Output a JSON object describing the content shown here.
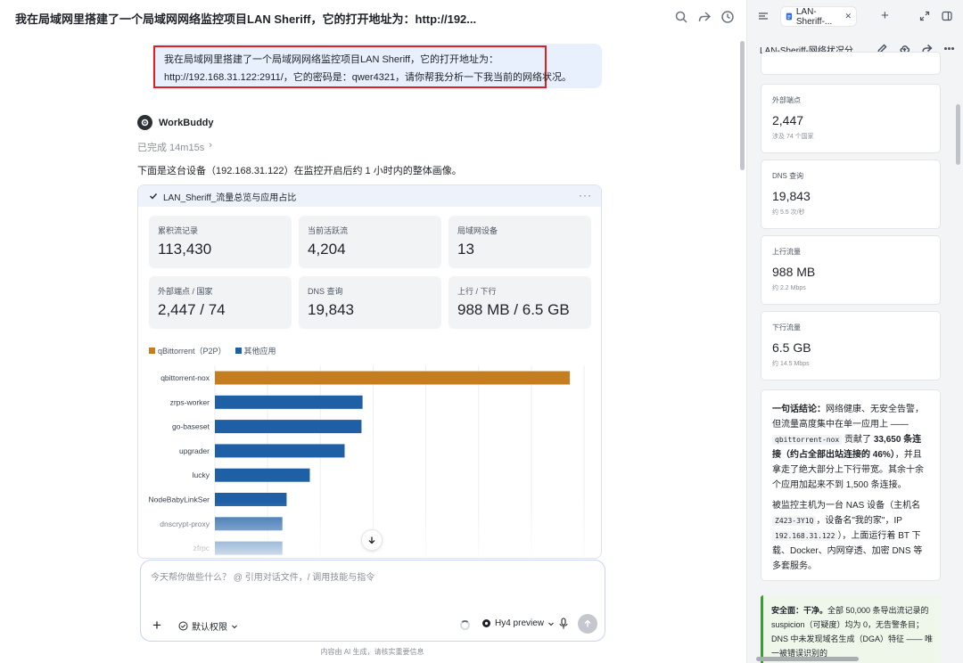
{
  "chat": {
    "title": "我在局域网里搭建了一个局域网网络监控项目LAN Sheriff，它的打开地址为：http://192...",
    "user_message_line1": "我在局域网里搭建了一个局域网网络监控项目LAN Sheriff，它的打开地址为：",
    "user_message_line2": "http://192.168.31.122:2911/，它的密码是：qwer4321，请你帮我分析一下我当前的网络状况。",
    "bot_name": "WorkBuddy",
    "done_label": "已完成 14m15s",
    "done_chevron": "›",
    "intro": "下面是这台设备（192.168.31.122）在监控开启后约 1 小时内的整体画像。"
  },
  "card": {
    "title": "LAN_Sheriff_流量总览与应用占比",
    "more": "···",
    "stats": [
      {
        "label": "累积流记录",
        "value": "113,430"
      },
      {
        "label": "当前活跃流",
        "value": "4,204"
      },
      {
        "label": "局域网设备",
        "value": "13"
      },
      {
        "label": "外部端点 / 国家",
        "value": "2,447 / 74"
      },
      {
        "label": "DNS 查询",
        "value": "19,843"
      },
      {
        "label": "上行 / 下行",
        "value": "988 MB / 6.5 GB"
      }
    ]
  },
  "chart_data": {
    "type": "bar",
    "orientation": "horizontal",
    "categories": [
      "qbittorrent-nox",
      "zrps-worker",
      "go-baseset",
      "upgrader",
      "lucky",
      "NodeBabyLinkSer",
      "dnscrypt-proxy",
      "zfrpc"
    ],
    "values": [
      33650,
      14000,
      13900,
      12300,
      9000,
      6800,
      6400,
      6400
    ],
    "series": [
      {
        "name": "qBittorrent（P2P）",
        "color": "#c47d1f",
        "indices": [
          0
        ]
      },
      {
        "name": "其他应用",
        "color": "#1f5fa6",
        "indices": [
          1,
          2,
          3,
          4,
          5,
          6,
          7
        ]
      }
    ],
    "xlim": [
      0,
      35000
    ],
    "legend": "top-left",
    "grid": true
  },
  "composer": {
    "placeholder": "今天帮你做些什么？ @ 引用对话文件，/ 调用技能与指令",
    "plus": "+",
    "permission": "默认权限",
    "model": "Hy4 preview",
    "disclaimer": "内容由 AI 生成，请核实重要信息"
  },
  "right": {
    "tab_label": "LAN-Sheriff-...",
    "doc_title": "LAN-Sheriff-网络状况分...",
    "cards": [
      {
        "label": "外部端点",
        "value": "2,447",
        "sub": "涉及 74 个国家"
      },
      {
        "label": "DNS 查询",
        "value": "19,843",
        "sub": "约 5.5 次/秒"
      },
      {
        "label": "上行流量",
        "value": "988 MB",
        "sub": "约 2.2 Mbps"
      },
      {
        "label": "下行流量",
        "value": "6.5 GB",
        "sub": "约 14.5 Mbps"
      }
    ],
    "summary": {
      "lead": "一句话结论：",
      "t1": "网络健康、无安全告警，但流量高度集中在单一应用上 ——",
      "code1": "qbittorrent-nox",
      "t2": "贡献了 ",
      "bold1": "33,650 条连接（约占全部出站连接的 46%）",
      "t3": "，并且拿走了绝大部分上下行带宽。其余十余个应用加起来不到 1,500 条连接。",
      "p2a": "被监控主机为一台 NAS 设备（主机名 ",
      "code2": "Z423-3Y1Q",
      "p2b": "，设备名\"我的家\"，IP ",
      "code3": "192.168.31.122",
      "p2c": "），上面运行着 BT 下载、Docker、内网穿透、加密 DNS 等多套服务。"
    },
    "safety": {
      "lead": "安全面：干净。",
      "t1": "全部 50,000 条导出流记录的 suspicion（可疑度）均为 0，无告警条目；DNS 中未发现域名生成（DGA）特征 —— 唯一被错误识别的",
      "t2": ""
    }
  }
}
